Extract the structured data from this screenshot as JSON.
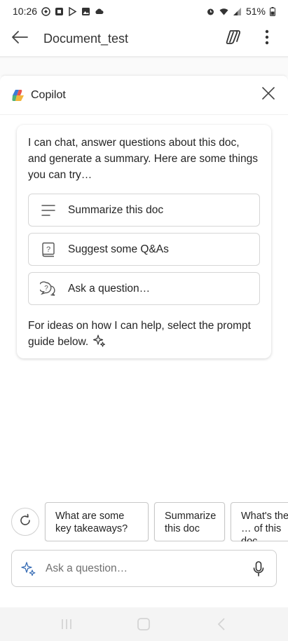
{
  "status_bar": {
    "time": "10:26",
    "battery": "51%",
    "left_icons": [
      "notification-icon",
      "media-icon",
      "play-store-icon",
      "gallery-icon",
      "cloud-icon"
    ],
    "right_icons": [
      "alarm-icon",
      "wifi-icon",
      "signal-icon",
      "battery-icon"
    ]
  },
  "header": {
    "title": "Document_test",
    "icons": [
      "back-arrow-icon",
      "copilot-icon",
      "more-vertical-icon"
    ]
  },
  "copilot": {
    "title": "Copilot",
    "intro": "I can chat, answer questions about this doc, and generate a summary. Here are some things you can try…",
    "suggestions": [
      {
        "label": "Summarize this doc",
        "icon": "summary-lines-icon"
      },
      {
        "label": "Suggest some Q&As",
        "icon": "question-book-icon"
      },
      {
        "label": "Ask a question…",
        "icon": "question-chat-icon"
      }
    ],
    "footer": "For ideas on how I can help, select the prompt guide below."
  },
  "prompt_chips": [
    "What are some key takeaways?",
    "Summarize this doc",
    "What's the … of this doc"
  ],
  "ask": {
    "placeholder": "Ask a question…"
  },
  "colors": {
    "text": "#242424",
    "border": "#d6d6d6",
    "copilot_red": "#e8554e",
    "copilot_blue": "#3b7dd8",
    "copilot_yellow": "#f2b63c",
    "copilot_green": "#4fb47a"
  }
}
